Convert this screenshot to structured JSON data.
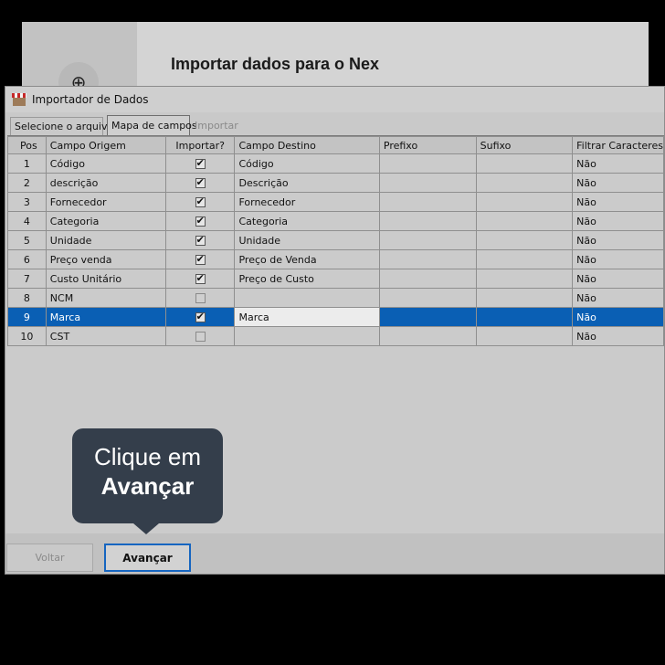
{
  "background_app": {
    "title": "Importar dados para o Nex",
    "logo_icon": "lifebuoy-icon"
  },
  "dialog": {
    "title": "Importador de Dados",
    "icon": "store-icon",
    "tabs": [
      {
        "label": "Selecione o arquivo",
        "state": "inactive"
      },
      {
        "label": "Mapa de campos",
        "state": "active"
      },
      {
        "label": "Importar",
        "state": "disabled"
      }
    ],
    "grid": {
      "columns": [
        "Pos",
        "Campo Origem",
        "Importar?",
        "Campo Destino",
        "Prefixo",
        "Sufixo",
        "Filtrar Caracteres"
      ],
      "rows": [
        {
          "pos": "1",
          "origem": "Código",
          "importar": true,
          "destino": "Código",
          "prefixo": "",
          "sufixo": "",
          "filtrar": "Não"
        },
        {
          "pos": "2",
          "origem": "descrição",
          "importar": true,
          "destino": "Descrição",
          "prefixo": "",
          "sufixo": "",
          "filtrar": "Não"
        },
        {
          "pos": "3",
          "origem": "Fornecedor",
          "importar": true,
          "destino": "Fornecedor",
          "prefixo": "",
          "sufixo": "",
          "filtrar": "Não"
        },
        {
          "pos": "4",
          "origem": "Categoria",
          "importar": true,
          "destino": "Categoria",
          "prefixo": "",
          "sufixo": "",
          "filtrar": "Não"
        },
        {
          "pos": "5",
          "origem": "Unidade",
          "importar": true,
          "destino": "Unidade",
          "prefixo": "",
          "sufixo": "",
          "filtrar": "Não"
        },
        {
          "pos": "6",
          "origem": "Preço venda",
          "importar": true,
          "destino": "Preço de Venda",
          "prefixo": "",
          "sufixo": "",
          "filtrar": "Não"
        },
        {
          "pos": "7",
          "origem": "Custo Unitário",
          "importar": true,
          "destino": "Preço de Custo",
          "prefixo": "",
          "sufixo": "",
          "filtrar": "Não"
        },
        {
          "pos": "8",
          "origem": "NCM",
          "importar": false,
          "destino": "",
          "prefixo": "",
          "sufixo": "",
          "filtrar": "Não"
        },
        {
          "pos": "9",
          "origem": "Marca",
          "importar": true,
          "destino": "Marca",
          "prefixo": "",
          "sufixo": "",
          "filtrar": "Não",
          "selected": true
        },
        {
          "pos": "10",
          "origem": "CST",
          "importar": false,
          "destino": "",
          "prefixo": "",
          "sufixo": "",
          "filtrar": "Não"
        }
      ]
    },
    "buttons": {
      "back": "Voltar",
      "next": "Avançar"
    }
  },
  "tooltip": {
    "line1": "Clique em",
    "line2": "Avançar"
  },
  "colors": {
    "selection": "#0a5fb4",
    "highlight_border": "#1565c0",
    "tooltip_bg": "#343e4b"
  }
}
